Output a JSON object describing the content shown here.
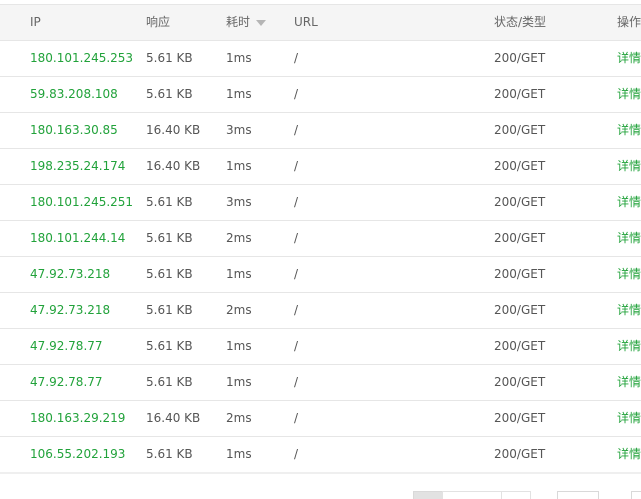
{
  "table": {
    "headers": {
      "ip": "IP",
      "response": "响应",
      "time": "耗时",
      "url": "URL",
      "status": "状态/类型",
      "operation": "操作"
    },
    "rows": [
      {
        "ip": "180.101.245.253",
        "response": "5.61 KB",
        "time": "1ms",
        "url": "/",
        "status": "200/GET",
        "op": "详情"
      },
      {
        "ip": "59.83.208.108",
        "response": "5.61 KB",
        "time": "1ms",
        "url": "/",
        "status": "200/GET",
        "op": "详情"
      },
      {
        "ip": "180.163.30.85",
        "response": "16.40 KB",
        "time": "3ms",
        "url": "/",
        "status": "200/GET",
        "op": "详情"
      },
      {
        "ip": "198.235.24.174",
        "response": "16.40 KB",
        "time": "1ms",
        "url": "/",
        "status": "200/GET",
        "op": "详情"
      },
      {
        "ip": "180.101.245.251",
        "response": "5.61 KB",
        "time": "3ms",
        "url": "/",
        "status": "200/GET",
        "op": "详情"
      },
      {
        "ip": "180.101.244.14",
        "response": "5.61 KB",
        "time": "2ms",
        "url": "/",
        "status": "200/GET",
        "op": "详情"
      },
      {
        "ip": "47.92.73.218",
        "response": "5.61 KB",
        "time": "1ms",
        "url": "/",
        "status": "200/GET",
        "op": "详情"
      },
      {
        "ip": "47.92.73.218",
        "response": "5.61 KB",
        "time": "2ms",
        "url": "/",
        "status": "200/GET",
        "op": "详情"
      },
      {
        "ip": "47.92.78.77",
        "response": "5.61 KB",
        "time": "1ms",
        "url": "/",
        "status": "200/GET",
        "op": "详情"
      },
      {
        "ip": "47.92.78.77",
        "response": "5.61 KB",
        "time": "1ms",
        "url": "/",
        "status": "200/GET",
        "op": "详情"
      },
      {
        "ip": "180.163.29.219",
        "response": "16.40 KB",
        "time": "2ms",
        "url": "/",
        "status": "200/GET",
        "op": "详情"
      },
      {
        "ip": "106.55.202.193",
        "response": "5.61 KB",
        "time": "1ms",
        "url": "/",
        "status": "200/GET",
        "op": "详情"
      }
    ]
  },
  "colors": {
    "link": "#21a23a",
    "header_bg": "#f5f5f5",
    "border": "#e6e6e6"
  },
  "icons": {
    "sort": "sort-caret-down-icon"
  }
}
